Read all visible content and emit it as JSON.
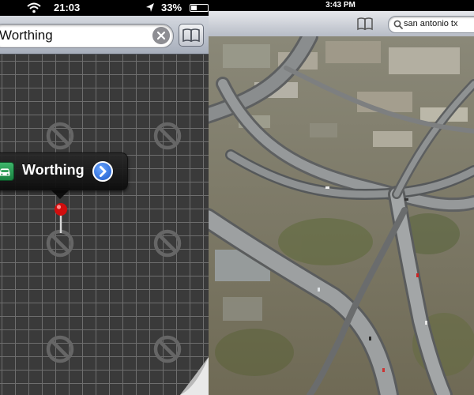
{
  "iphone": {
    "status": {
      "time": "21:03",
      "battery": "33%",
      "battery_level": 0.33
    },
    "search": {
      "value": "Worthing",
      "clear_icon": "clear-icon",
      "bookmarks_icon": "bookmarks-icon"
    },
    "callout": {
      "title": "Worthing",
      "left_icon": "car-icon",
      "right_icon": "disclosure-icon"
    },
    "tile_placeholder_icon": "no-symbol-icon",
    "pin_icon": "map-pin-icon"
  },
  "ipad": {
    "status": {
      "time": "3:43 PM"
    },
    "search": {
      "value": "san antonio tx",
      "icon": "search-icon"
    },
    "bookmarks_icon": "bookmarks-icon",
    "map_view": "satellite"
  },
  "colors": {
    "grid_bg": "#3a3a3a",
    "grid_line": "#6e6e6e",
    "callout_bg": "#141414",
    "disclosure_blue": "#1856c8",
    "pin_red": "#d10e0e",
    "car_green": "#18803f"
  }
}
